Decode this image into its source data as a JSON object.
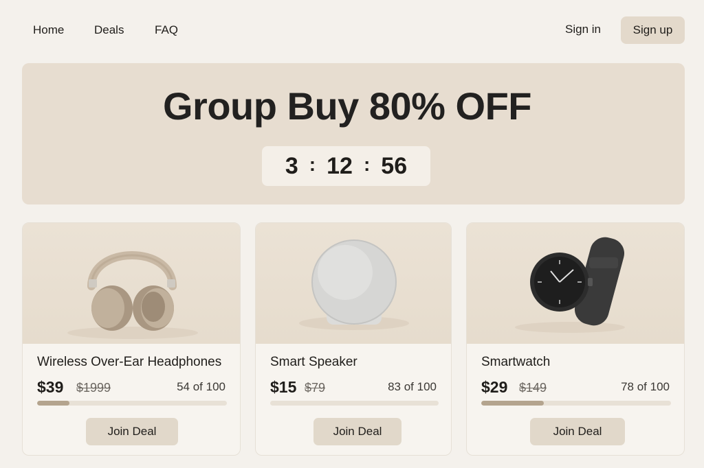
{
  "nav": {
    "links": [
      "Home",
      "Deals",
      "FAQ"
    ],
    "sign_in": "Sign in",
    "sign_up": "Sign up"
  },
  "hero": {
    "title": "Group Buy 80% OFF",
    "timer": {
      "hours": "3",
      "minutes": "12",
      "seconds": "56",
      "separator": ":"
    }
  },
  "products": [
    {
      "name": "Wireless Over-Ear Headphones",
      "price": "$39",
      "original_price": "$1999",
      "progress_text": "54 of 100",
      "progress": 0.17,
      "button": "Join Deal",
      "icon": "headphones-icon"
    },
    {
      "name": "Smart Speaker",
      "price": "$15",
      "original_price": "$79",
      "progress_text": "83 of 100",
      "progress": 0.0,
      "button": "Join Deal",
      "icon": "speaker-icon"
    },
    {
      "name": "Smartwatch",
      "price": "$29",
      "original_price": "$149",
      "progress_text": "78 of 100",
      "progress": 0.33,
      "button": "Join Deal",
      "icon": "smartwatch-icon"
    }
  ],
  "colors": {
    "background": "#f4f1ec",
    "hero": "#e7ddd0",
    "accent": "#e3d9cb",
    "progress": "#b4a48e"
  }
}
